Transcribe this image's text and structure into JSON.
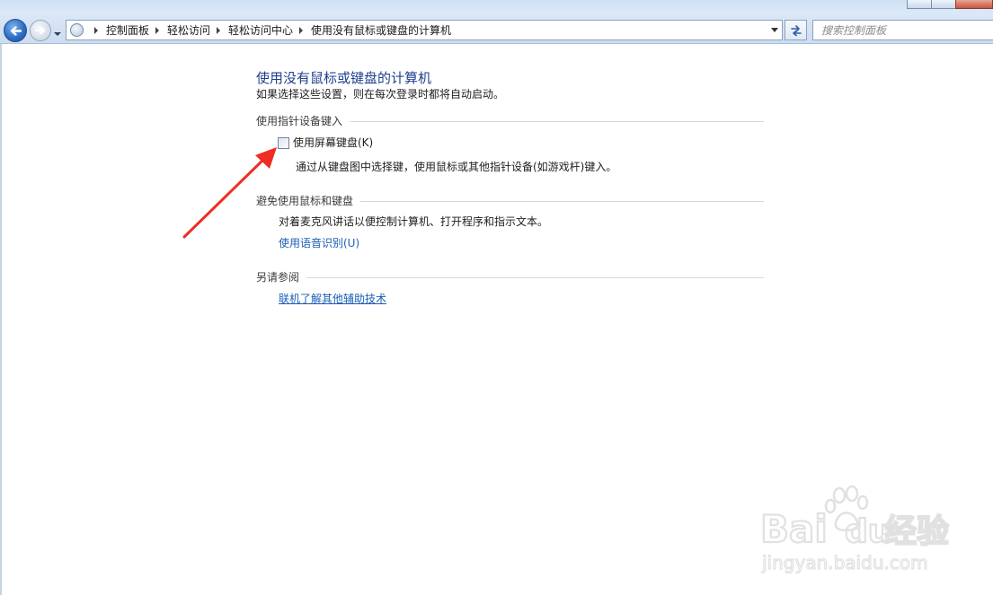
{
  "address_bar": {
    "breadcrumbs": [
      "控制面板",
      "轻松访问",
      "轻松访问中心",
      "使用没有鼠标或键盘的计算机"
    ]
  },
  "search": {
    "placeholder": "搜索控制面板"
  },
  "page": {
    "title": "使用没有鼠标或键盘的计算机",
    "description": "如果选择这些设置，则在每次登录时都将自动启动。"
  },
  "sections": {
    "pointing": {
      "heading": "使用指针设备键入",
      "checkbox_label": "使用屏幕键盘(K)",
      "checkbox_checked": false,
      "description": "通过从键盘图中选择键，使用鼠标或其他指针设备(如游戏杆)键入。"
    },
    "avoid": {
      "heading": "避免使用鼠标和键盘",
      "description": "对着麦克风讲话以便控制计算机、打开程序和指示文本。",
      "link": "使用语音识别(U)"
    },
    "see_also": {
      "heading": "另请参阅",
      "link": "联机了解其他辅助技术"
    }
  },
  "watermark": {
    "brand": "Bai",
    "brand2": "du",
    "product": "经验",
    "url": "jingyan.baidu.com"
  },
  "colors": {
    "title": "#1e3f8e",
    "link": "#1a5fb4",
    "annotation_arrow": "#ee2d24"
  }
}
